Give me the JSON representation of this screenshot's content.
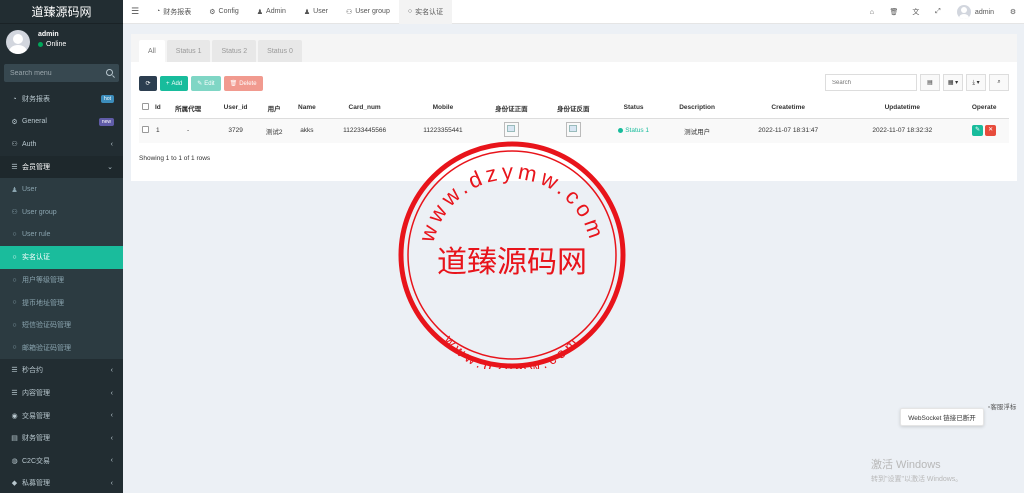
{
  "sidebar": {
    "brand": "道臻源码网",
    "user": {
      "name": "admin",
      "status": "Online"
    },
    "search_placeholder": "Search menu",
    "items": [
      {
        "label": "财务报表",
        "icon": "dashboard-icon",
        "badge": "hot",
        "badge_color": "#3c8dbc",
        "kind": "top"
      },
      {
        "label": "General",
        "icon": "cogs-icon",
        "badge": "new",
        "badge_color": "#605ca8",
        "kind": "top"
      },
      {
        "label": "Auth",
        "icon": "group-icon",
        "chevron": "‹",
        "kind": "top"
      },
      {
        "label": "会员管理",
        "icon": "list-icon",
        "chevron": "⌄",
        "kind": "section"
      },
      {
        "label": "User",
        "icon": "user-icon",
        "kind": "sub"
      },
      {
        "label": "User group",
        "icon": "users-icon",
        "kind": "sub"
      },
      {
        "label": "User rule",
        "icon": "circle-icon",
        "kind": "sub"
      },
      {
        "label": "实名认证",
        "icon": "circle-icon",
        "kind": "active"
      },
      {
        "label": "用户等级管理",
        "icon": "circle-icon",
        "kind": "sub"
      },
      {
        "label": "提币地址管理",
        "icon": "circle-icon",
        "kind": "sub"
      },
      {
        "label": "短信验证码管理",
        "icon": "circle-icon",
        "kind": "sub"
      },
      {
        "label": "邮箱验证码管理",
        "icon": "circle-icon",
        "kind": "sub"
      },
      {
        "label": "秒合约",
        "icon": "list-icon",
        "chevron": "‹",
        "kind": "top"
      },
      {
        "label": "内容管理",
        "icon": "list-icon",
        "chevron": "‹",
        "kind": "top"
      },
      {
        "label": "交易管理",
        "icon": "eye-icon",
        "chevron": "‹",
        "kind": "top"
      },
      {
        "label": "财务管理",
        "icon": "book-icon",
        "chevron": "‹",
        "kind": "top"
      },
      {
        "label": "C2C交易",
        "icon": "globe-icon",
        "chevron": "‹",
        "kind": "top"
      },
      {
        "label": "私募管理",
        "icon": "diamond-icon",
        "chevron": "‹",
        "kind": "top"
      }
    ]
  },
  "topnav": {
    "tabs": [
      {
        "label": "财务报表",
        "icon": "dashboard-icon",
        "glyph": "◔"
      },
      {
        "label": "Config",
        "icon": "cog-icon",
        "glyph": "⚙"
      },
      {
        "label": "Admin",
        "icon": "user-icon",
        "glyph": "♟"
      },
      {
        "label": "User",
        "icon": "user-icon",
        "glyph": "♟"
      },
      {
        "label": "User group",
        "icon": "users-icon",
        "glyph": "⚇"
      },
      {
        "label": "实名认证",
        "icon": "circle-icon",
        "glyph": "○",
        "active": true
      }
    ],
    "right_icons": [
      "home-icon",
      "trash-icon",
      "language-icon",
      "fullscreen-icon"
    ],
    "user": "admin"
  },
  "panel": {
    "tabs": [
      {
        "label": "All",
        "active": true
      },
      {
        "label": "Status 1"
      },
      {
        "label": "Status 2"
      },
      {
        "label": "Status 0"
      }
    ],
    "toolbar": {
      "add": "Add",
      "edit": "Edit",
      "delete": "Delete"
    },
    "search_placeholder": "Search",
    "columns": [
      "Id",
      "所属代理",
      "User_id",
      "用户",
      "Name",
      "Card_num",
      "Mobile",
      "身份证正面",
      "身份证反面",
      "Status",
      "Description",
      "Createtime",
      "Updatetime",
      "Operate"
    ],
    "rows": [
      {
        "id": "1",
        "agent": "-",
        "user_id": "3729",
        "user": "测试2",
        "name": "akks",
        "card_num": "112233445566",
        "mobile": "11223355441",
        "status": "Status 1",
        "description": "测试用户",
        "createtime": "2022-11-07 18:31:47",
        "updatetime": "2022-11-07 18:32:32"
      }
    ],
    "showing": "Showing 1 to 1 of 1 rows"
  },
  "watermark": {
    "center_text": "道臻源码网",
    "ring_top": "www.dzymw.com",
    "ring_bottom": "www.dzymw.com"
  },
  "notice": {
    "websocket": "WebSocket 链接已断开",
    "side_img_alt": "客服浮标"
  },
  "windows": {
    "line1": "激活 Windows",
    "line2": "转到\"设置\"以激活 Windows。"
  },
  "colors": {
    "sidebar_bg": "#222d32",
    "accent": "#18bc9c",
    "danger": "#e74c3c",
    "stamp_red": "#e8141b"
  }
}
